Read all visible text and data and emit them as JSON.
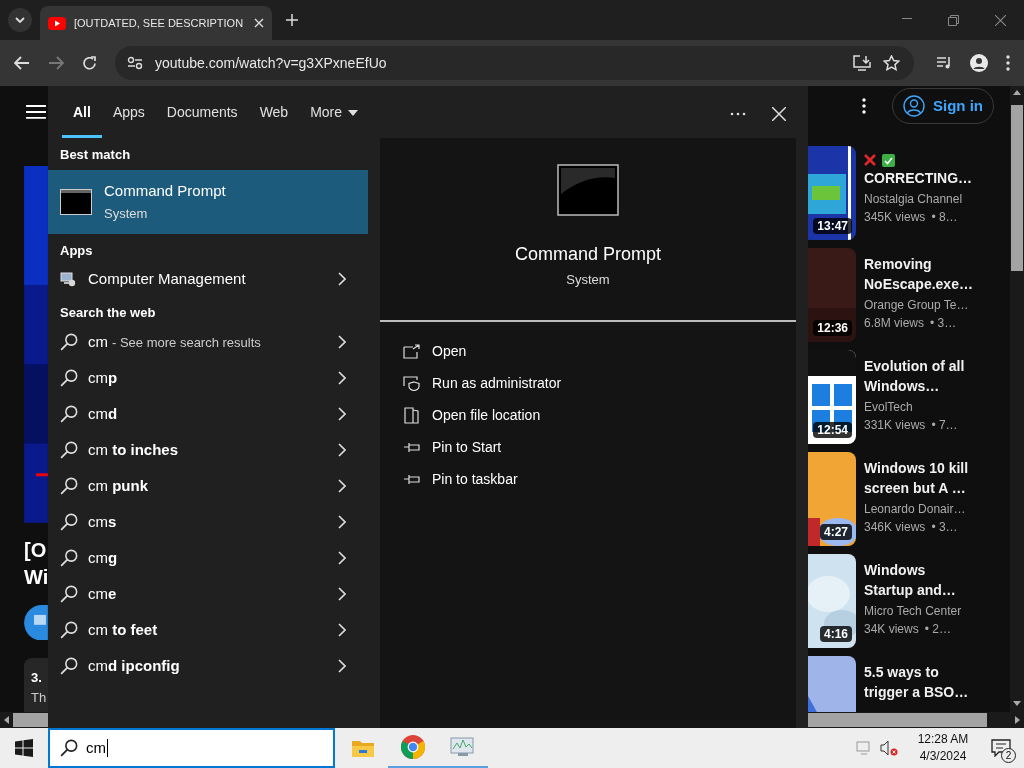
{
  "browser": {
    "tab": {
      "title": "[OUTDATED, SEE DESCRIPTION"
    },
    "url": "youtube.com/watch?v=g3XPxneEfUo"
  },
  "page": {
    "left": {
      "title_lines": [
        "[O",
        "Wi"
      ],
      "card_lines": [
        "3.",
        "Th"
      ]
    },
    "sign_in": "Sign in",
    "videos": [
      {
        "duration": "13:47",
        "has_marks": true,
        "title_lines": [
          "CORRECTING…"
        ],
        "channel": "Nostalgia Channel",
        "views": "345K views",
        "age": "• 8…"
      },
      {
        "duration": "12:36",
        "title_lines": [
          "Removing",
          "NoEscape.exe…"
        ],
        "channel": "Orange Group Te…",
        "views": "6.8M views",
        "age": "• 3…"
      },
      {
        "duration": "12:54",
        "title_lines": [
          "Evolution of all",
          "Windows…"
        ],
        "channel": "EvolTech",
        "views": "331K views",
        "age": "• 7…"
      },
      {
        "duration": "4:27",
        "title_lines": [
          "Windows 10 kill",
          "screen but A …"
        ],
        "channel": "Leonardo Donair…",
        "views": "346K views",
        "age": "• 3…"
      },
      {
        "duration": "4:16",
        "title_lines": [
          "Windows",
          "Startup and…"
        ],
        "channel": "Micro Tech Center",
        "views": "34K views",
        "age": "• 2…"
      },
      {
        "title_lines": [
          "5.5 ways to",
          "trigger a BSO…"
        ]
      }
    ]
  },
  "search": {
    "tabs": [
      {
        "label": "All",
        "selected": true
      },
      {
        "label": "Apps",
        "selected": false
      },
      {
        "label": "Documents",
        "selected": false
      },
      {
        "label": "Web",
        "selected": false
      },
      {
        "label": "More",
        "selected": false
      }
    ],
    "sections": [
      {
        "heading": "Best match",
        "items": [
          {
            "kind": "best",
            "title": "Command Prompt",
            "subtitle": "System",
            "selected": true
          }
        ]
      },
      {
        "heading": "Apps",
        "items": [
          {
            "kind": "app",
            "title": "Computer Management",
            "selected": false
          }
        ]
      },
      {
        "heading": "Search the web",
        "items": [
          {
            "kind": "web",
            "title": "cm",
            "hint": "- See more search results",
            "selected": false
          },
          {
            "kind": "web",
            "title": "cm**p**",
            "selected": false
          },
          {
            "kind": "web",
            "title": "cm**d**",
            "selected": false
          },
          {
            "kind": "web",
            "title": "cm **to inches**",
            "selected": false
          },
          {
            "kind": "web",
            "title": "cm **punk**",
            "selected": false
          },
          {
            "kind": "web",
            "title": "cm**s**",
            "selected": false
          },
          {
            "kind": "web",
            "title": "cm**g**",
            "selected": false
          },
          {
            "kind": "web",
            "title": "cm**e**",
            "selected": false
          },
          {
            "kind": "web",
            "title": "cm **to feet**",
            "selected": false
          },
          {
            "kind": "web",
            "title": "cm**d ipconfig**",
            "selected": false
          }
        ]
      }
    ],
    "preview": {
      "title": "Command Prompt",
      "subtitle": "System",
      "actions": [
        {
          "kind": "open",
          "label": "Open"
        },
        {
          "kind": "admin",
          "label": "Run as administrator"
        },
        {
          "kind": "location",
          "label": "Open file location"
        },
        {
          "kind": "pin",
          "label": "Pin to Start"
        },
        {
          "kind": "pin",
          "label": "Pin to taskbar"
        }
      ]
    }
  },
  "taskbar": {
    "search_value": "cm",
    "time": "12:28 AM",
    "date": "4/3/2024",
    "notifications": "2"
  }
}
